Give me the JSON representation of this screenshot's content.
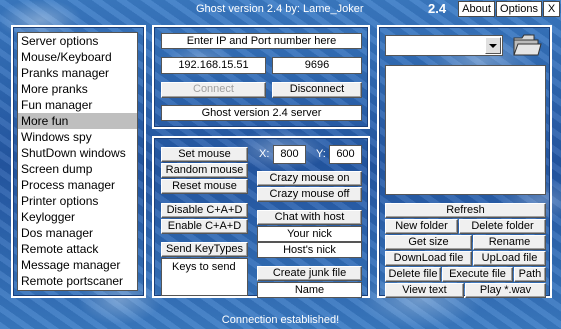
{
  "window": {
    "title": "Ghost version 2.4 by: Lame_Joker",
    "version": "2.4",
    "menu": [
      "About",
      "Options",
      "X"
    ]
  },
  "menu_list": {
    "items": [
      "Server options",
      "Mouse/Keyboard",
      "Pranks manager",
      "More pranks",
      "Fun manager",
      "More fun",
      "Windows spy",
      "ShutDown windows",
      "Screen dump",
      "Process manager",
      "Printer options",
      "Keylogger",
      "Dos manager",
      "Remote attack",
      "Message manager",
      "Remote portscaner"
    ],
    "selected": "More fun"
  },
  "connection": {
    "prompt": "Enter IP and Port number here",
    "ip": "192.168.15.51",
    "port": "9696",
    "connect_label": "Connect",
    "disconnect_label": "Disconnect",
    "server_version": "Ghost version 2.4 server"
  },
  "fun": {
    "set_mouse": "Set mouse",
    "random_mouse": "Random mouse",
    "reset_mouse": "Reset mouse",
    "x_label": "X:",
    "x_value": "800",
    "y_label": "Y:",
    "y_value": "600",
    "crazy_on": "Crazy mouse on",
    "crazy_off": "Crazy mouse off",
    "disable_cad": "Disable C+A+D",
    "enable_cad": "Enable C+A+D",
    "chat_with_host": "Chat with host",
    "your_nick": "Your nick",
    "hosts_nick": "Host's nick",
    "send_keytypes": "Send KeyTypes",
    "keys_to_send": "Keys to send",
    "create_junk": "Create junk file",
    "name": "Name"
  },
  "files": {
    "refresh": "Refresh",
    "new_folder": "New folder",
    "delete_folder": "Delete folder",
    "get_size": "Get size",
    "rename": "Rename",
    "download": "DownLoad file",
    "upload": "UpLoad file",
    "delete_file": "Delete file",
    "execute_file": "Execute file",
    "path": "Path",
    "view_text": "View text",
    "play_wav": "Play *.wav"
  },
  "status": "Connection established!",
  "icons": {
    "folder": "folder-icon",
    "dropdown": "chevron-down-icon"
  },
  "colors": {
    "background": "#2d6ab7",
    "selected_item": "#bfbfbf"
  }
}
